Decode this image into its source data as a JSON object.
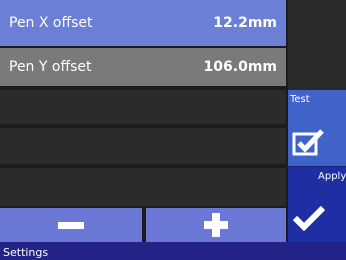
{
  "params": {
    "items": [
      {
        "label": "Pen X offset",
        "value": "12.2mm"
      },
      {
        "label": "Pen Y offset",
        "value": "106.0mm"
      }
    ]
  },
  "side": {
    "test_label": "Test",
    "apply_label": "Apply"
  },
  "controls": {
    "decrement_icon": "minus-icon",
    "increment_icon": "plus-icon"
  },
  "status": {
    "text": "Settings"
  },
  "colors": {
    "selected_row": "#6b7fd7",
    "row": "#7a7a7a",
    "empty_row": "#2b2b2b",
    "test_button": "#3f63c9",
    "apply_button": "#1e2fa4",
    "status_bar": "#232387"
  }
}
